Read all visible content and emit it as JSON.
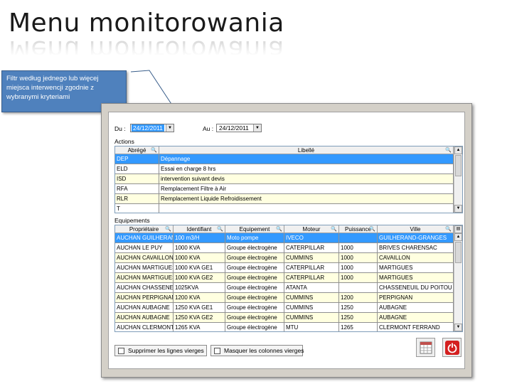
{
  "slide": {
    "title": "Menu monitorowania",
    "callout": "Filtr według jednego lub więcej miejsca interwencji zgodnie z wybranymi kryteriami"
  },
  "filters": {
    "du_label": "Du :",
    "du_value": "24/12/2011",
    "au_label": "Au :",
    "au_value": "24/12/2011"
  },
  "actions": {
    "section_label": "Actions",
    "columns": [
      "Abrégé",
      "Libellé"
    ],
    "rows": [
      [
        "DEP",
        "Dépannage"
      ],
      [
        "ELD",
        "Essai en charge 8 hrs"
      ],
      [
        "ISD",
        "intervention suivant devis"
      ],
      [
        "RFA",
        "Remplacement Filtre à Air"
      ],
      [
        "RLR",
        "Remplacement Liquide Refroidissement"
      ],
      [
        "T",
        ""
      ]
    ]
  },
  "equipements": {
    "section_label": "Equipements",
    "columns": [
      "Propriétaire",
      "Identifiant",
      "Equipement",
      "Moteur",
      "Puissance",
      "Ville"
    ],
    "rows": [
      [
        "AUCHAN GUILHERAND",
        "100 m3/H",
        "Moto pompe",
        "IVECO",
        "",
        "GUILHERAND-GRANGES"
      ],
      [
        "AUCHAN LE PUY",
        "1000 KVA",
        "Groupe électrogène",
        "CATERPILLAR",
        "1000",
        " BRIVES CHARENSAC"
      ],
      [
        "AUCHAN CAVAILLON",
        "1000 KVA",
        "Groupe électrogène",
        "CUMMINS",
        "1000",
        "CAVAILLON"
      ],
      [
        "AUCHAN MARTIGUES",
        "1000 KVA GE1",
        "Groupe électrogène",
        "CATERPILLAR",
        "1000",
        "MARTIGUES"
      ],
      [
        "AUCHAN MARTIGUES",
        "1000 KVA GE2",
        "Groupe électrogène",
        "CATERPILLAR",
        "1000",
        "MARTIGUES"
      ],
      [
        "AUCHAN CHASSENEUIL",
        "1025KVA",
        "Groupe électrogène",
        "ATANTA",
        "",
        "CHASSENEUIL DU POITOU"
      ],
      [
        "AUCHAN PERPIGNAN",
        "1200 KVA",
        "Groupe électrogène",
        "CUMMINS",
        "1200",
        "PERPIGNAN"
      ],
      [
        "AUCHAN AUBAGNE",
        "1250 KVA GE1",
        "Groupe électrogène",
        "CUMMINS",
        "1250",
        "AUBAGNE"
      ],
      [
        "AUCHAN AUBAGNE",
        "1250 KVA GE2",
        "Groupe électrogène",
        "CUMMINS",
        "1250",
        "AUBAGNE"
      ],
      [
        "AUCHAN CLERMONT",
        "1265 KVA",
        "Groupe électrogène",
        "MTU",
        "1265",
        "CLERMONT FERRAND"
      ]
    ]
  },
  "options": {
    "suppress_empty_rows": "Supprimer les lignes vierges",
    "hide_empty_columns": "Masquer les colonnes vierges"
  },
  "icons": {
    "export": "spreadsheet-icon",
    "quit": "power-icon"
  },
  "colors": {
    "selection": "#3399ff",
    "row_alt": "#ffffe0",
    "callout": "#4f81bd",
    "quit_button": "#d42020"
  }
}
